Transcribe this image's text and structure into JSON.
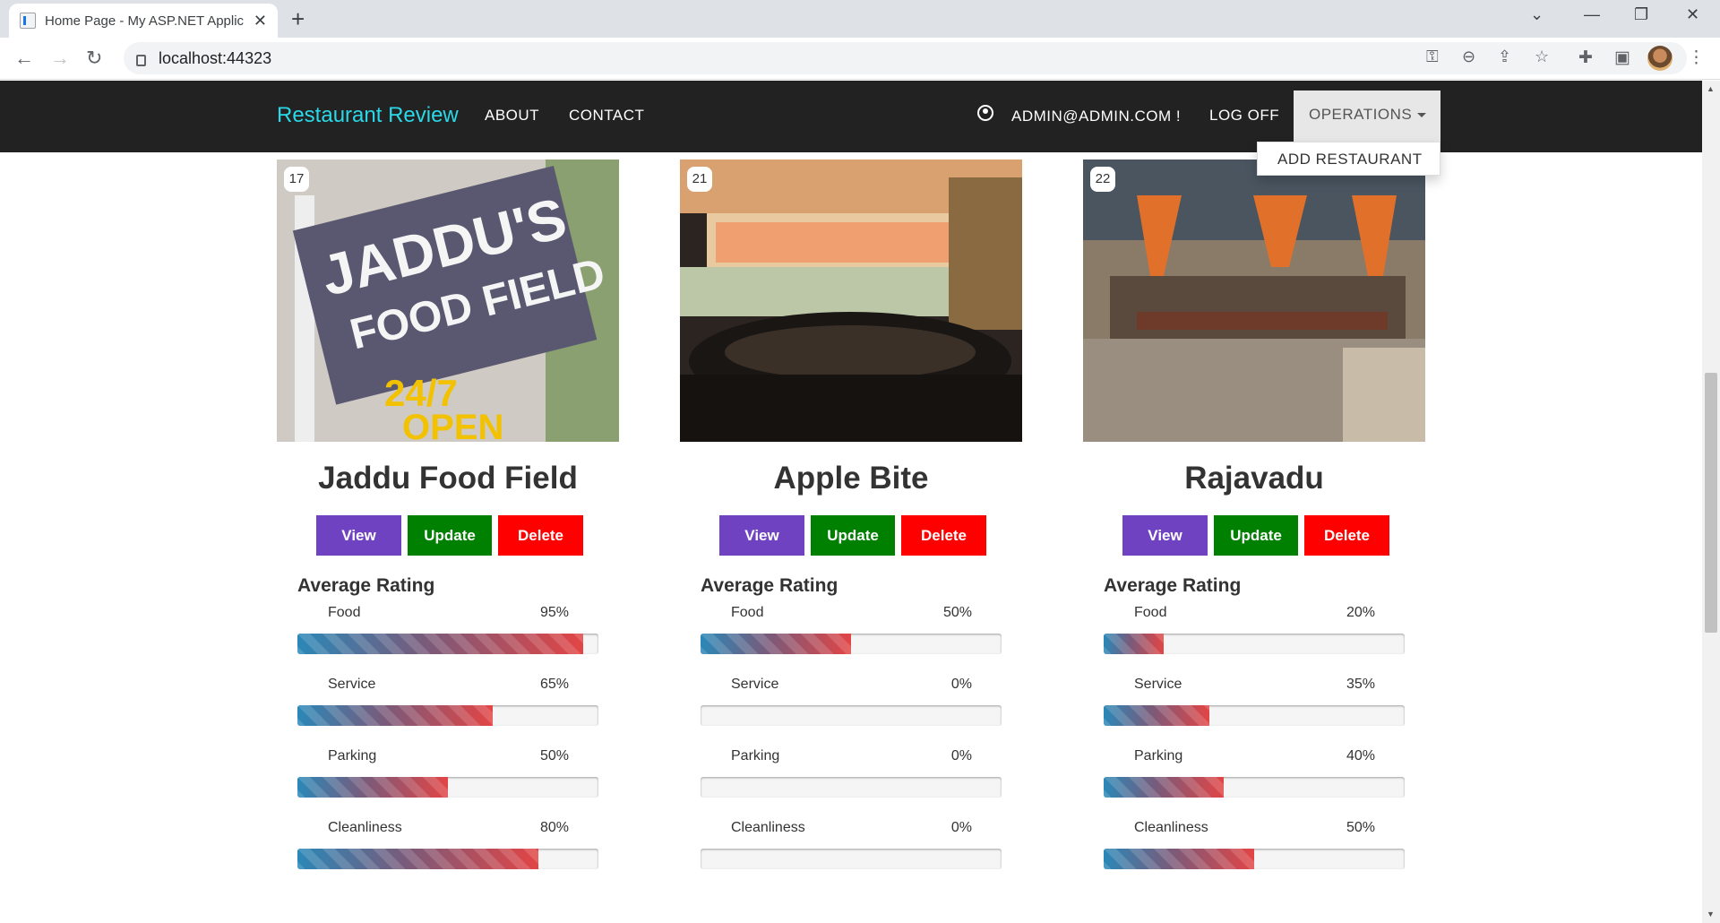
{
  "browser": {
    "tab_title": "Home Page - My ASP.NET Applic",
    "url": "localhost:44323"
  },
  "navbar": {
    "brand": "Restaurant Review",
    "about": "ABOUT",
    "contact": "CONTACT",
    "user": "ADMIN@ADMIN.COM !",
    "logoff": "LOG OFF",
    "operations": "OPERATIONS",
    "dropdown_item": "ADD RESTAURANT"
  },
  "colors": {
    "brand": "#2bd8e8",
    "navbar_bg": "#222222",
    "view_button": "#6f42c1",
    "update_button": "#008000",
    "delete_button": "#ff0000"
  },
  "buttons": {
    "view": "View",
    "update": "Update",
    "delete": "Delete"
  },
  "rating_heading": "Average Rating",
  "restaurants": [
    {
      "id": "17",
      "name": "Jaddu Food Field",
      "image_sign": [
        "JADDU'S",
        "FOOD FIELD",
        "24/7",
        "OPEN"
      ],
      "ratings": [
        {
          "label": "Food",
          "value": 95,
          "text": "95%"
        },
        {
          "label": "Service",
          "value": 65,
          "text": "65%"
        },
        {
          "label": "Parking",
          "value": 50,
          "text": "50%"
        },
        {
          "label": "Cleanliness",
          "value": 80,
          "text": "80%"
        }
      ]
    },
    {
      "id": "21",
      "name": "Apple Bite",
      "ratings": [
        {
          "label": "Food",
          "value": 50,
          "text": "50%"
        },
        {
          "label": "Service",
          "value": 0,
          "text": "0%"
        },
        {
          "label": "Parking",
          "value": 0,
          "text": "0%"
        },
        {
          "label": "Cleanliness",
          "value": 0,
          "text": "0%"
        }
      ]
    },
    {
      "id": "22",
      "name": "Rajavadu",
      "ratings": [
        {
          "label": "Food",
          "value": 20,
          "text": "20%"
        },
        {
          "label": "Service",
          "value": 35,
          "text": "35%"
        },
        {
          "label": "Parking",
          "value": 40,
          "text": "40%"
        },
        {
          "label": "Cleanliness",
          "value": 50,
          "text": "50%"
        }
      ]
    }
  ]
}
